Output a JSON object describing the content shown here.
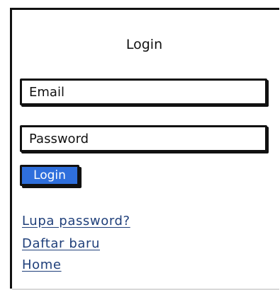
{
  "title": "Login",
  "fields": {
    "email_placeholder": "Email",
    "password_placeholder": "Password"
  },
  "login_button": "Login",
  "links": {
    "forgot_password": "Lupa password?",
    "register": "Daftar baru",
    "home": "Home"
  },
  "colors": {
    "button_bg": "#2f6fdc",
    "link": "#1f3f7a",
    "border": "#111111"
  }
}
